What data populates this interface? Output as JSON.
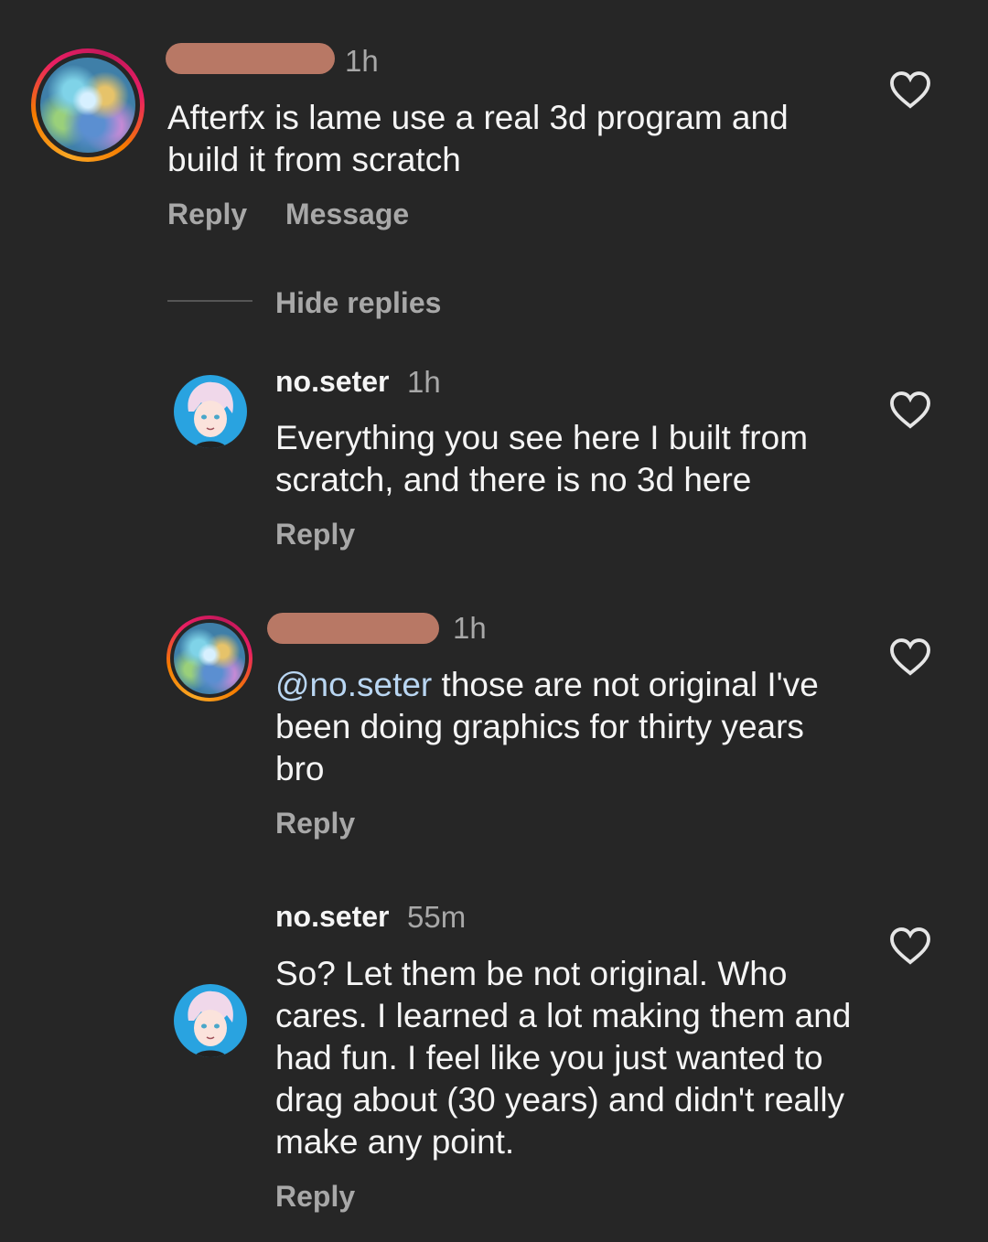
{
  "comment": {
    "time": "1h",
    "text": "Afterfx is lame use a real 3d program and build it from scratch",
    "reply_label": "Reply",
    "message_label": "Message"
  },
  "hide_replies_label": "Hide replies",
  "replies": [
    {
      "username": "no.seter",
      "time": "1h",
      "text": "Everything you see here I built from scratch, and there is no 3d here",
      "reply_label": "Reply"
    },
    {
      "time": "1h",
      "mention": "@no.seter",
      "text": " those are not original I've been doing graphics for thirty years bro",
      "reply_label": "Reply"
    },
    {
      "username": "no.seter",
      "time": "55m",
      "text": "So? Let them be not original. Who cares. I learned a lot making them and had fun. I feel like you just wanted to drag about (30 years) and didn't really make any point.",
      "reply_label": "Reply"
    }
  ],
  "icons": {
    "like": "heart-outline-icon"
  },
  "colors": {
    "background": "#262626",
    "text": "#f5f5f5",
    "secondary_text": "#a8a8a8",
    "mention": "#b9d6f2",
    "redaction": "#b87865"
  }
}
